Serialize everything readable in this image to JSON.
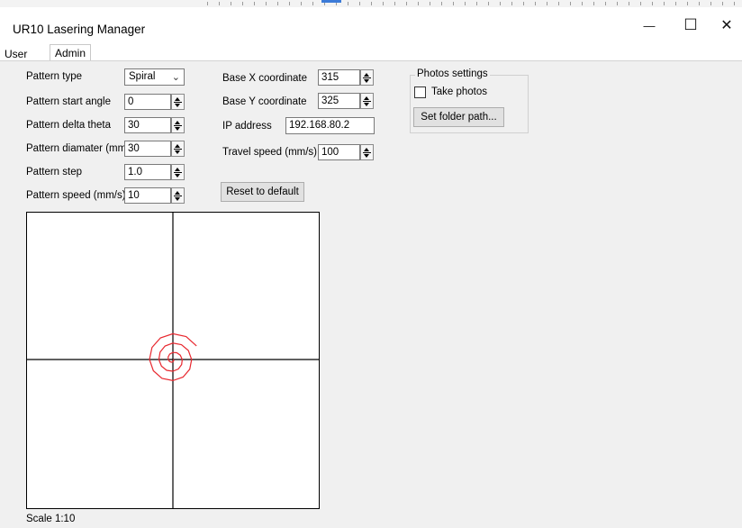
{
  "window": {
    "title": "UR10 Lasering Manager",
    "minimize_glyph": "—",
    "maximize_glyph": "☐",
    "close_glyph": "✕"
  },
  "tabs": [
    {
      "label": "User",
      "active": false
    },
    {
      "label": "Admin",
      "active": true
    }
  ],
  "pattern": {
    "type_label": "Pattern type",
    "type_value": "Spiral",
    "start_angle_label": "Pattern start angle",
    "start_angle_value": "0",
    "delta_theta_label": "Pattern delta theta",
    "delta_theta_value": "30",
    "diameter_label": "Pattern diamater (mm)",
    "diameter_value": "30",
    "step_label": "Pattern step",
    "step_value": "1.0",
    "speed_label": "Pattern speed (mm/s)",
    "speed_value": "10"
  },
  "base": {
    "x_label": "Base X coordinate",
    "x_value": "315",
    "y_label": "Base Y coordinate",
    "y_value": "325",
    "ip_label": "IP address",
    "ip_value": "192.168.80.2",
    "travel_label": "Travel speed (mm/s)",
    "travel_value": "100",
    "reset_label": "Reset to default"
  },
  "photos": {
    "group_title": "Photos settings",
    "take_photos_label": "Take photos",
    "take_photos_checked": false,
    "folder_button": "Set folder path..."
  },
  "preview": {
    "scale_label": "Scale 1:10",
    "spiral_color": "#e8282f",
    "axis_color": "#000000"
  },
  "icons": {
    "dropdown": "chevron-down-icon",
    "spinner": "spinner-arrows-icon"
  }
}
